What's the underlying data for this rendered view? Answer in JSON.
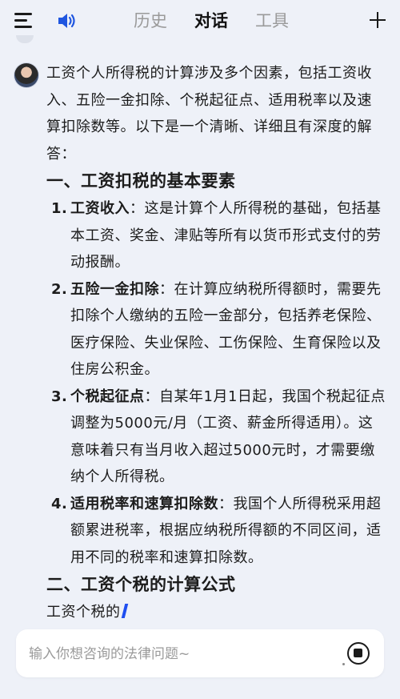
{
  "header": {
    "tabs": [
      {
        "label": "历史",
        "active": false
      },
      {
        "label": "对话",
        "active": true
      },
      {
        "label": "工具",
        "active": false
      }
    ]
  },
  "message": {
    "intro": "工资个人所得税的计算涉及多个因素，包括工资收入、五险一金扣除、个税起征点、适用税率以及速算扣除数等。以下是一个清晰、详细且有深度的解答：",
    "section1_title": "一、工资扣税的基本要素",
    "items": [
      {
        "num": "1.",
        "term": "工资收入",
        "text": "：这是计算个人所得税的基础，包括基本工资、奖金、津贴等所有以货币形式支付的劳动报酬。"
      },
      {
        "num": "2.",
        "term": "五险一金扣除",
        "text": "：在计算应纳税所得额时，需要先扣除个人缴纳的五险一金部分，包括养老保险、医疗保险、失业保险、工伤保险、生育保险以及住房公积金。"
      },
      {
        "num": "3.",
        "term": "个税起征点",
        "text": "：自某年1月1日起，我国个税起征点调整为5000元/月（工资、薪金所得适用）。这意味着只有当月收入超过5000元时，才需要缴纳个人所得税。"
      },
      {
        "num": "4.",
        "term": "适用税率和速算扣除数",
        "text": "：我国个人所得税采用超额累进税率，根据应纳税所得额的不同区间，适用不同的税率和速算扣除数。"
      }
    ],
    "section2_title": "二、工资个税的计算公式",
    "partial_text": "工资个税的"
  },
  "input": {
    "placeholder": "输入你想咨询的法律问题~",
    "value": ""
  },
  "colors": {
    "background": "#eef1f8",
    "accent": "#1f4ef0",
    "speaker_icon": "#1f56e0"
  },
  "icons": [
    "menu-icon",
    "speaker-icon",
    "plus-icon",
    "avatar",
    "stop-icon"
  ]
}
